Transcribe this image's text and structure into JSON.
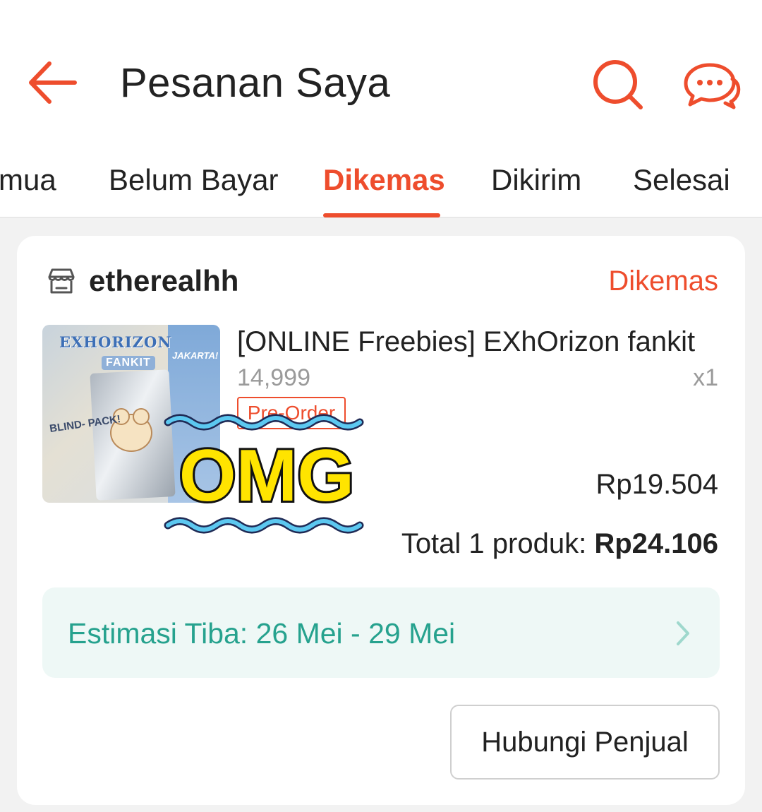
{
  "header": {
    "title": "Pesanan Saya",
    "back_icon": "arrow-left-icon",
    "search_icon": "search-icon",
    "chat_icon": "chat-icon",
    "accent_color": "#ee4d2d"
  },
  "tabs": [
    {
      "label": "mua",
      "active": false
    },
    {
      "label": "Belum Bayar",
      "active": false
    },
    {
      "label": "Dikemas",
      "active": true
    },
    {
      "label": "Dikirim",
      "active": false
    },
    {
      "label": "Selesai",
      "active": false
    }
  ],
  "order": {
    "shop_icon": "store-icon",
    "shop_name": "etherealhh",
    "status": "Dikemas",
    "product": {
      "name": "[ONLINE Freebies] EXhOrizon fankit",
      "variant": "14,999",
      "quantity": "x1",
      "badge": "Pre-Order",
      "price": "Rp19.504",
      "thumbnail": {
        "title": "EXHORIZON",
        "subtitle": "FANKIT",
        "city": "JAKARTA!",
        "blind_pack": "BLIND- PACK!"
      }
    },
    "total_label": "Total 1 produk:",
    "total_amount": "Rp24.106",
    "eta": {
      "text": "Estimasi Tiba: 26 Mei - 29 Mei",
      "color": "#26a28e",
      "chevron_icon": "chevron-right-icon"
    },
    "contact_button": "Hubungi Penjual",
    "sticker_text": "OMG"
  }
}
